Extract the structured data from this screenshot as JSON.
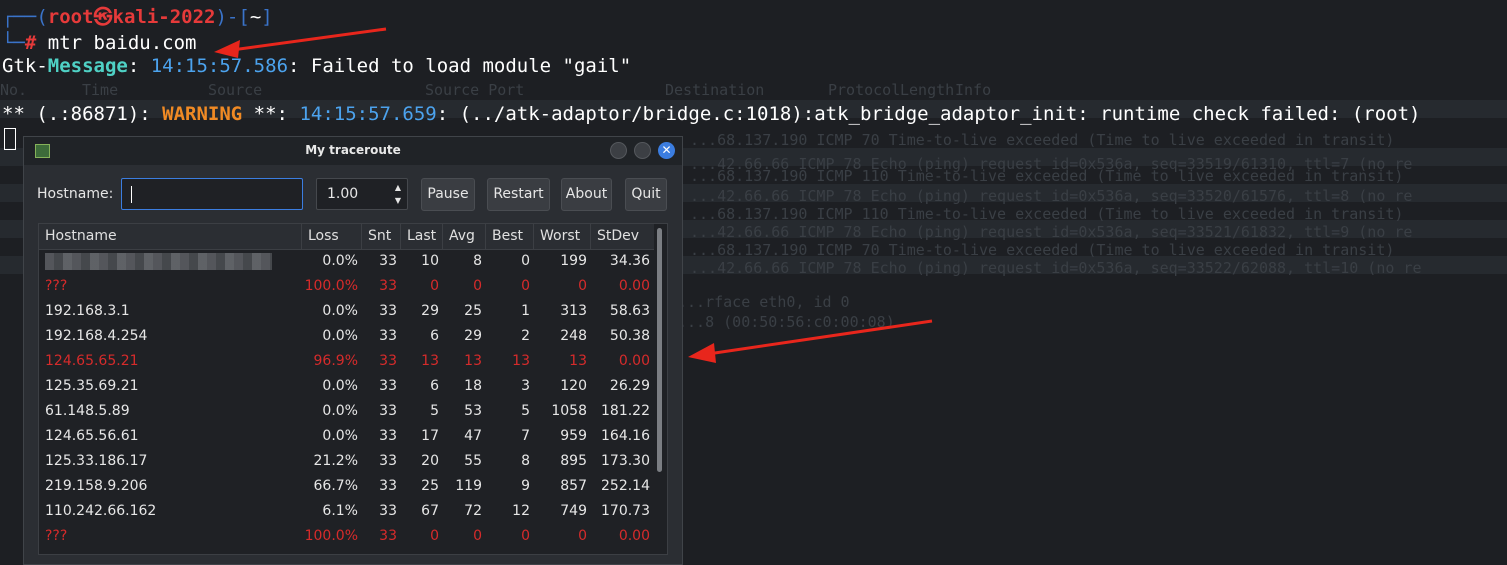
{
  "terminal": {
    "prompt_top": "┌──(",
    "prompt_user": "root㉿kali-2022",
    "prompt_mid": ")-[",
    "prompt_dir": "~",
    "prompt_end": "]",
    "prompt_bottom": "└─",
    "prompt_hash": "#",
    "command": " mtr baidu.com",
    "gtk_prefix": "Gtk-",
    "gtk_level": "Message",
    "gtk_colon": ": ",
    "gtk_time": "14:15:57.586",
    "gtk_msg": ": Failed to load module \"gail\"",
    "warn_prefix": "** (.:86871): ",
    "warn_level": "WARNING",
    "warn_stars": " **: ",
    "warn_time": "14:15:57.659",
    "warn_msg": ": (../atk-adaptor/bridge.c:1018):atk_bridge_adaptor_init: runtime check failed: (root)"
  },
  "window": {
    "title": "My traceroute",
    "hostname_label": "Hostname:",
    "hostname_value": "",
    "interval_value": "1.00",
    "buttons": {
      "pause": "Pause",
      "restart": "Restart",
      "about": "About",
      "quit": "Quit"
    },
    "close_glyph": "✕"
  },
  "table": {
    "columns": [
      "Hostname",
      "Loss",
      "Snt",
      "Last",
      "Avg",
      "Best",
      "Worst",
      "StDev"
    ],
    "rows": [
      {
        "host": "",
        "loss": "0.0%",
        "snt": "33",
        "last": "10",
        "avg": "8",
        "best": "0",
        "worst": "199",
        "stdev": "34.36",
        "lost": false,
        "redacted": true
      },
      {
        "host": "???",
        "loss": "100.0%",
        "snt": "33",
        "last": "0",
        "avg": "0",
        "best": "0",
        "worst": "0",
        "stdev": "0.00",
        "lost": true
      },
      {
        "host": "192.168.3.1",
        "loss": "0.0%",
        "snt": "33",
        "last": "29",
        "avg": "25",
        "best": "1",
        "worst": "313",
        "stdev": "58.63",
        "lost": false
      },
      {
        "host": "192.168.4.254",
        "loss": "0.0%",
        "snt": "33",
        "last": "6",
        "avg": "29",
        "best": "2",
        "worst": "248",
        "stdev": "50.38",
        "lost": false
      },
      {
        "host": "124.65.65.21",
        "loss": "96.9%",
        "snt": "33",
        "last": "13",
        "avg": "13",
        "best": "13",
        "worst": "13",
        "stdev": "0.00",
        "lost": true
      },
      {
        "host": "125.35.69.21",
        "loss": "0.0%",
        "snt": "33",
        "last": "6",
        "avg": "18",
        "best": "3",
        "worst": "120",
        "stdev": "26.29",
        "lost": false
      },
      {
        "host": "61.148.5.89",
        "loss": "0.0%",
        "snt": "33",
        "last": "5",
        "avg": "53",
        "best": "5",
        "worst": "1058",
        "stdev": "181.22",
        "lost": false
      },
      {
        "host": "124.65.56.61",
        "loss": "0.0%",
        "snt": "33",
        "last": "17",
        "avg": "47",
        "best": "7",
        "worst": "959",
        "stdev": "164.16",
        "lost": false
      },
      {
        "host": "125.33.186.17",
        "loss": "21.2%",
        "snt": "33",
        "last": "20",
        "avg": "55",
        "best": "8",
        "worst": "895",
        "stdev": "173.30",
        "lost": false
      },
      {
        "host": "219.158.9.206",
        "loss": "66.7%",
        "snt": "33",
        "last": "25",
        "avg": "119",
        "best": "9",
        "worst": "857",
        "stdev": "252.14",
        "lost": false
      },
      {
        "host": "110.242.66.162",
        "loss": "6.1%",
        "snt": "33",
        "last": "67",
        "avg": "72",
        "best": "12",
        "worst": "749",
        "stdev": "170.73",
        "lost": false
      },
      {
        "host": "???",
        "loss": "100.0%",
        "snt": "33",
        "last": "0",
        "avg": "0",
        "best": "0",
        "worst": "0",
        "stdev": "0.00",
        "lost": true
      }
    ]
  },
  "background": {
    "header": [
      "No.",
      "Time",
      "Source",
      "Source Port",
      "Destination",
      "Protocol",
      "Length",
      "Info"
    ],
    "lines": [
      "...68.137.190          ICMP        70 Time-to-live exceeded (Time to live exceeded in transit)",
      "...42.66.66            ICMP        78 Echo (ping) request  id=0x536a, seq=33519/61310, ttl=7 (no re",
      "...68.137.190          ICMP       110 Time-to-live exceeded (Time to live exceeded in transit)",
      "...42.66.66            ICMP        78 Echo (ping) request  id=0x536a, seq=33520/61576, ttl=8 (no re",
      "...68.137.190          ICMP       110 Time-to-live exceeded (Time to live exceeded in transit)",
      "...42.66.66            ICMP        78 Echo (ping) request  id=0x536a, seq=33521/61832, ttl=9 (no re",
      "...68.137.190          ICMP        70 Time-to-live exceeded (Time to live exceeded in transit)",
      "...42.66.66            ICMP        78 Echo (ping) request  id=0x536a, seq=33522/62088, ttl=10 (no re"
    ],
    "iface1": "...rface eth0, id 0",
    "iface2": "...8 (00:50:56:c0:00:08)"
  },
  "colors": {
    "accent": "#3b7de0",
    "lost_row": "#d62b2b",
    "arrow": "#e8261c"
  }
}
